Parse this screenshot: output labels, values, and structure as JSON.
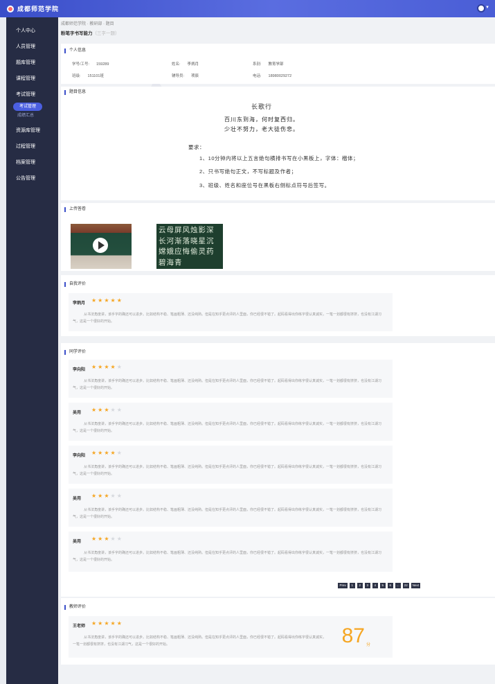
{
  "app": {
    "title": "成都师范学院"
  },
  "sidebar": {
    "items": [
      {
        "label": "个人中心"
      },
      {
        "label": "人员管理"
      },
      {
        "label": "题库管理"
      },
      {
        "label": "课程管理"
      },
      {
        "label": "考试管理"
      }
    ],
    "active_sub": "考试管理",
    "sub2": "成绩汇总",
    "items_after": [
      {
        "label": "资源库管理"
      },
      {
        "label": "过程管理"
      },
      {
        "label": "档案管理"
      },
      {
        "label": "公告管理"
      }
    ]
  },
  "breadcrumb": "成都师范学院 · 教研部 · 题目",
  "page_title": "粉笔字书写能力",
  "page_title_sub": "（三字一题）",
  "personal": {
    "section": "个人信息",
    "fields": [
      {
        "label": "学号/工号:",
        "value": "159289"
      },
      {
        "label": "姓名:",
        "value": "李炳月"
      },
      {
        "label": "系别:",
        "value": "教育学部"
      },
      {
        "label": "班级:",
        "value": "151101班"
      },
      {
        "label": "辅导员:",
        "value": "项辰"
      },
      {
        "label": "电话:",
        "value": "18980029272"
      }
    ]
  },
  "question": {
    "section": "题目信息",
    "title": "长歌行",
    "lines": [
      "百川东到海，何时复西归。",
      "少壮不努力，老大徒伤悲。"
    ],
    "req_label": "要求：",
    "reqs": [
      "1、10分钟内将以上五言绝句横排书写在小黑板上，字体：楷体；",
      "2、只书写绝句正文，不写标题及作者；",
      "3、班级、姓名和座位号在黑板右侧标点符号后签写。"
    ]
  },
  "upload": {
    "section": "上传答卷",
    "calligraphy": "云母屏风烛影深长河渐落晓星沉嫦娥应悔偷灵药碧海青"
  },
  "self_eval": {
    "section": "自我评价",
    "name": "李炳月",
    "stars": 5,
    "text": "从书法角度讲，该手字的确还可以进步。比如结构不稳、笔画粗薄、还没纯熟。但是在知乎更点评的人里面，你已经很不错了。起码看得出你练字很认真诚实，一笔一划都很有挤挤，也没有江湖习气，这是一个很好的开始。"
  },
  "peer_eval": {
    "section": "同学评价",
    "reviews": [
      {
        "name": "李向阳",
        "stars": 4
      },
      {
        "name": "吴用",
        "stars": 3
      },
      {
        "name": "李向阳",
        "stars": 4
      },
      {
        "name": "吴用",
        "stars": 3
      },
      {
        "name": "吴用",
        "stars": 3
      }
    ],
    "text": "从书法角度讲，该手字的确还可以进步。比如结构不稳、笔画粗薄、还没纯熟。但是在知乎更点评的人里面，你已经很不错了。起码看得出你练字很认真诚实，一笔一划都很有挤挤，也没有江湖习气，这是一个很好的开始。"
  },
  "pager": {
    "prev": "Prev",
    "pages": [
      "1",
      "2",
      "3",
      "4",
      "5",
      "6",
      "...",
      "22"
    ],
    "next": "Next"
  },
  "teacher_eval": {
    "section": "教师评价",
    "name": "王老师",
    "stars": 5,
    "text": "从书法角度讲，该手字的确还可以进步。比如结构不稳、笔画粗薄、还没纯熟。但是在知乎更点评的人里面，你已经很不错了。起码看得出你练字很认真诚实，一笔一划都很有挤挤，也没有江湖习气，这是一个很好的开始。",
    "score": "87",
    "score_unit": "分"
  },
  "colors": {
    "accent": "#3a4ec9",
    "sidebar": "#262c44",
    "star": "#f5a623"
  }
}
